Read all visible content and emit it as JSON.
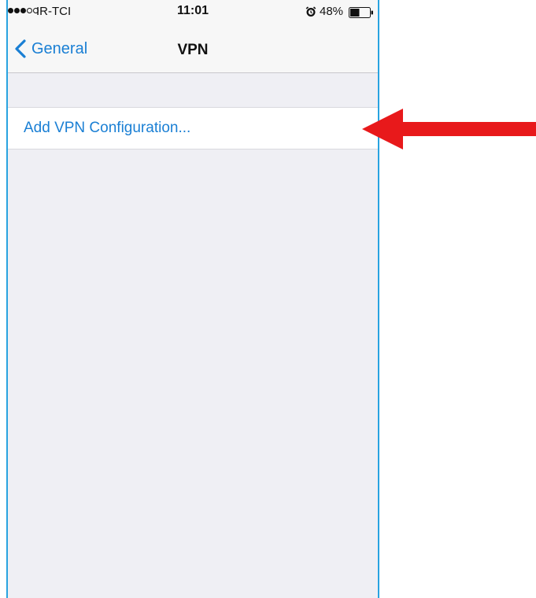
{
  "status_bar": {
    "signal_dots_filled": 3,
    "signal_dots_total": 5,
    "carrier": "IR-TCI",
    "time": "11:01",
    "alarm_icon": "alarm-clock-icon",
    "battery_percent_label": "48%",
    "battery_level": 0.48
  },
  "nav": {
    "back_label": "General",
    "back_icon": "chevron-left-icon",
    "title": "VPN"
  },
  "list": {
    "add_config_label": "Add VPN Configuration..."
  },
  "colors": {
    "accent": "#1a7fd4",
    "background": "#efeff4",
    "annotation_arrow": "#e8191b",
    "frame_border": "#29a3e0"
  }
}
